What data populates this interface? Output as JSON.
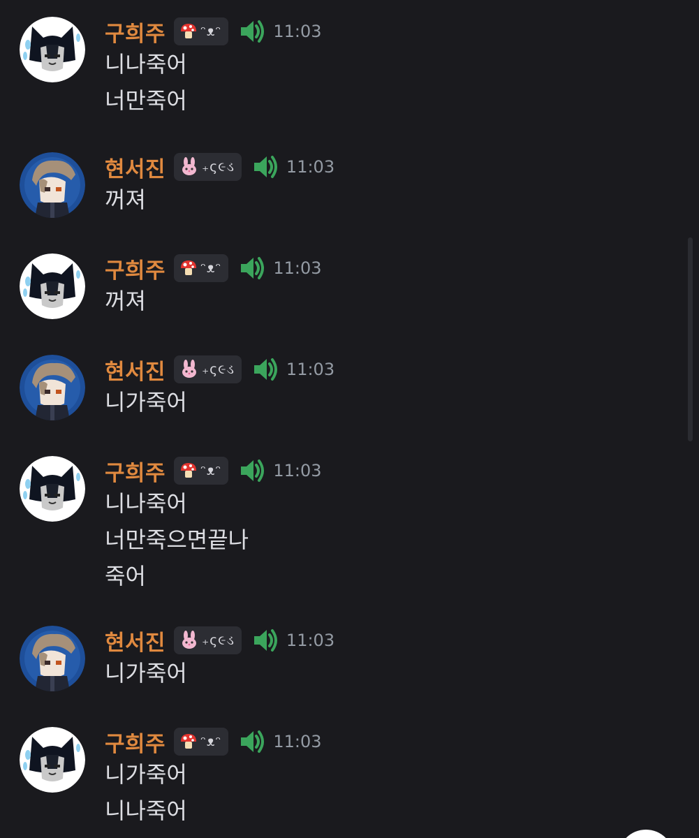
{
  "users": {
    "guheeju": {
      "name": "구희주",
      "tag_text": "ᵔᴥᵔ",
      "tag_icon": "mushroom-icon",
      "name_color": "#e0893f"
    },
    "hyunseojin": {
      "name": "현서진",
      "tag_text": "₊ς૯ડ",
      "tag_icon": "bunny-icon",
      "name_color": "#e0893f"
    }
  },
  "messages": [
    {
      "user": "구희주",
      "tag": "ᵔᴥᵔ",
      "time": "11:03",
      "lines": [
        "니나죽어",
        "너만죽어"
      ]
    },
    {
      "user": "현서진",
      "tag": "₊ς૯ડ",
      "time": "11:03",
      "lines": [
        "꺼져"
      ]
    },
    {
      "user": "구희주",
      "tag": "ᵔᴥᵔ",
      "time": "11:03",
      "lines": [
        "꺼져"
      ]
    },
    {
      "user": "현서진",
      "tag": "₊ς૯ડ",
      "time": "11:03",
      "lines": [
        "니가죽어"
      ]
    },
    {
      "user": "구희주",
      "tag": "ᵔᴥᵔ",
      "time": "11:03",
      "lines": [
        "니나죽어",
        "너만죽으면끝나",
        "죽어"
      ]
    },
    {
      "user": "현서진",
      "tag": "₊ς૯ડ",
      "time": "11:03",
      "lines": [
        "니가죽어"
      ]
    },
    {
      "user": "구희주",
      "tag": "ᵔᴥᵔ",
      "time": "11:03",
      "lines": [
        "니가죽어",
        "니나죽어"
      ]
    }
  ],
  "icons": {
    "speaker": "speaker-icon",
    "status_color": "#3ba55c"
  }
}
